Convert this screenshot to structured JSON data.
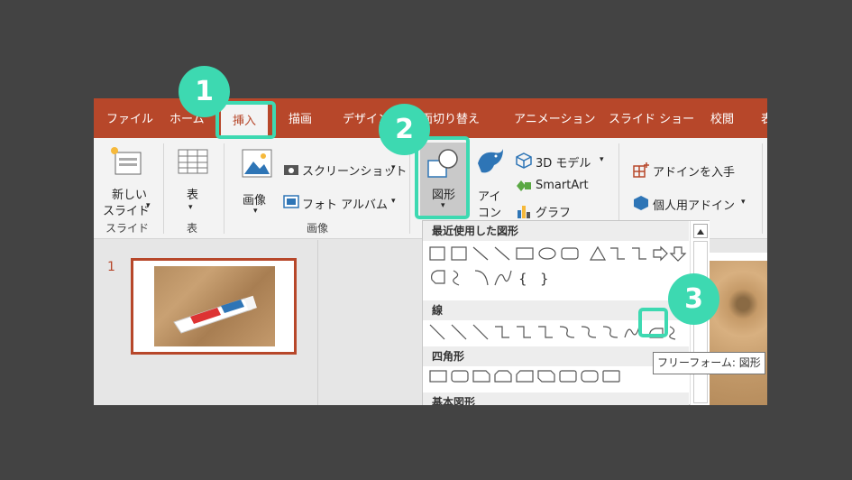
{
  "tabs": [
    "ファイル",
    "ホーム",
    "挿入",
    "描画",
    "デザイン",
    "画面切り替え",
    "アニメーション",
    "スライド ショー",
    "校閲",
    "表"
  ],
  "ribbon": {
    "new_slide_line1": "新しい",
    "new_slide_line2": "スライド",
    "slides_group": "スライド",
    "table_label": "表",
    "table_group": "表",
    "image_label": "画像",
    "screenshot_label": "スクリーンショット",
    "photo_album_label": "フォト アルバム",
    "images_group": "画像",
    "shapes_label": "図形",
    "icons_line1": "アイ",
    "icons_line2": "コン",
    "model3d_label": "3D モデル",
    "smartart_label": "SmartArt",
    "chart_label": "グラフ",
    "get_addins_label": "アドインを入手",
    "my_addins_label": "個人用アドイン",
    "dropdown_arrow": "▾"
  },
  "gallery": {
    "sections": [
      "最近使用した図形",
      "線",
      "四角形",
      "基本図形"
    ],
    "tooltip": "フリーフォーム: 図形"
  },
  "slide_pane": {
    "slide_number": "1"
  },
  "callouts": [
    "1",
    "2",
    "3"
  ],
  "colors": {
    "accent": "#b7472a",
    "callout": "#3dd9b1",
    "background": "#434343"
  }
}
